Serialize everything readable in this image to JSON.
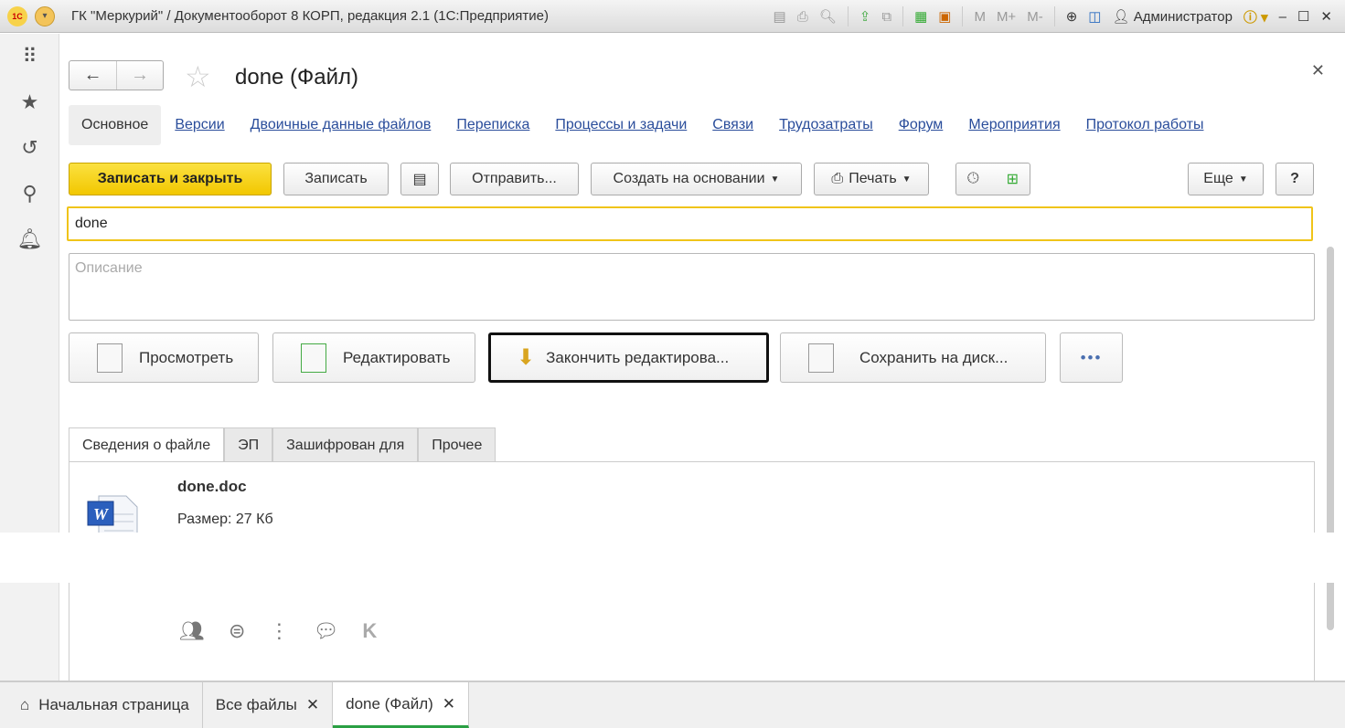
{
  "window": {
    "title": "ГК \"Меркурий\" / Документооборот 8 КОРП, редакция 2.1  (1С:Предприятие)",
    "logo": "1С",
    "user": "Администратор",
    "memory": [
      "M",
      "M+",
      "M-"
    ]
  },
  "form": {
    "title": "done (Файл)"
  },
  "links": [
    "Основное",
    "Версии",
    "Двоичные данные файлов",
    "Переписка",
    "Процессы и задачи",
    "Связи",
    "Трудозатраты",
    "Форум",
    "Мероприятия",
    "Протокол работы"
  ],
  "toolbar": {
    "save_close": "Записать и закрыть",
    "save": "Записать",
    "send": "Отправить...",
    "create_based": "Создать на основании",
    "print": "Печать",
    "more": "Еще",
    "help": "?"
  },
  "name_value": "done",
  "description_placeholder": "Описание",
  "actions": {
    "view": "Просмотреть",
    "edit": "Редактировать",
    "finish": "Закончить редактирова...",
    "save_disk": "Сохранить на диск...",
    "ellipsis": "•••"
  },
  "tabs": [
    "Сведения о файле",
    "ЭП",
    "Зашифрован для",
    "Прочее"
  ],
  "file": {
    "name": "done.doc",
    "size": "Размер: 27 Кб",
    "icon_letter": "W"
  },
  "bottom_tabs": [
    "Начальная страница",
    "Все файлы",
    "done (Файл)"
  ],
  "colors": {
    "accent": "#f2c700",
    "link": "#2a4d9b",
    "active_tab": "#2aa043"
  }
}
